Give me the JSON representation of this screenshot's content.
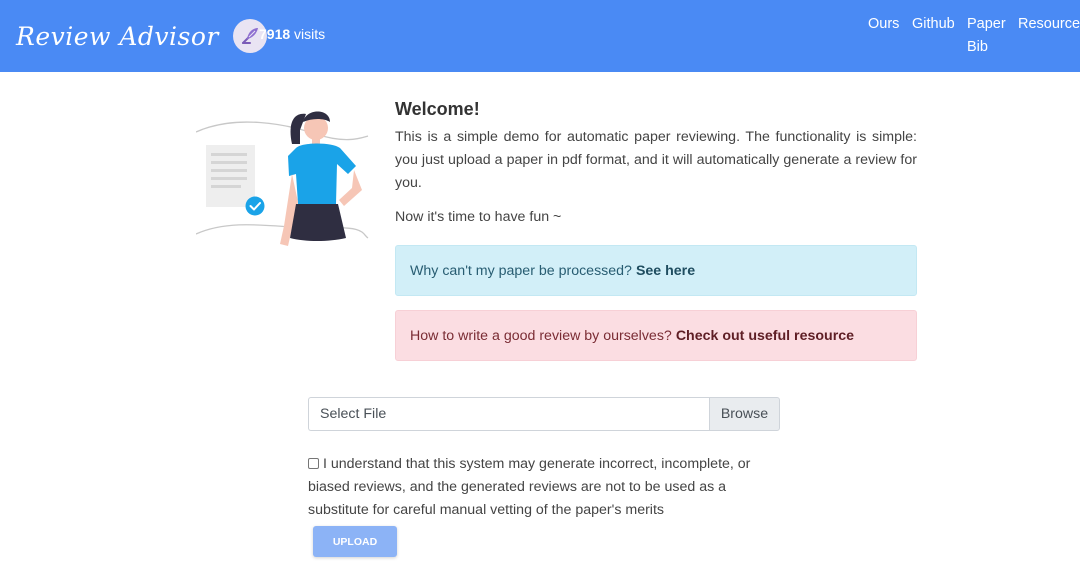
{
  "header": {
    "brand": "Review Advisor",
    "visits_count": "7918",
    "visits_label": "visits",
    "nav": [
      "Ours",
      "Github",
      "Paper",
      "Resource",
      "Bib"
    ]
  },
  "welcome": {
    "title": "Welcome!",
    "description": "This is a simple demo for automatic paper reviewing. The functionality is simple: you just upload a paper in pdf format, and it will automatically generate a review for you.",
    "fun_line": "Now it's time to have fun ~"
  },
  "alerts": {
    "info_text": "Why can't my paper be processed?",
    "info_link": "See here",
    "danger_text": "How to write a good review by ourselves?",
    "danger_link": "Check out useful resource"
  },
  "file": {
    "placeholder": "Select File",
    "browse": "Browse"
  },
  "consent": {
    "text": "I understand that this system may generate incorrect, incomplete, or biased reviews, and the generated reviews are not to be used as a substitute for careful manual vetting of the paper's merits",
    "checked": false
  },
  "upload": {
    "label": "UPLOAD"
  },
  "colors": {
    "navbar": "#4a8af4",
    "info_bg": "#d2eff8",
    "danger_bg": "#fbdde2",
    "upload_btn": "#8cb3f6",
    "illustration_shirt": "#1aa3e8"
  }
}
